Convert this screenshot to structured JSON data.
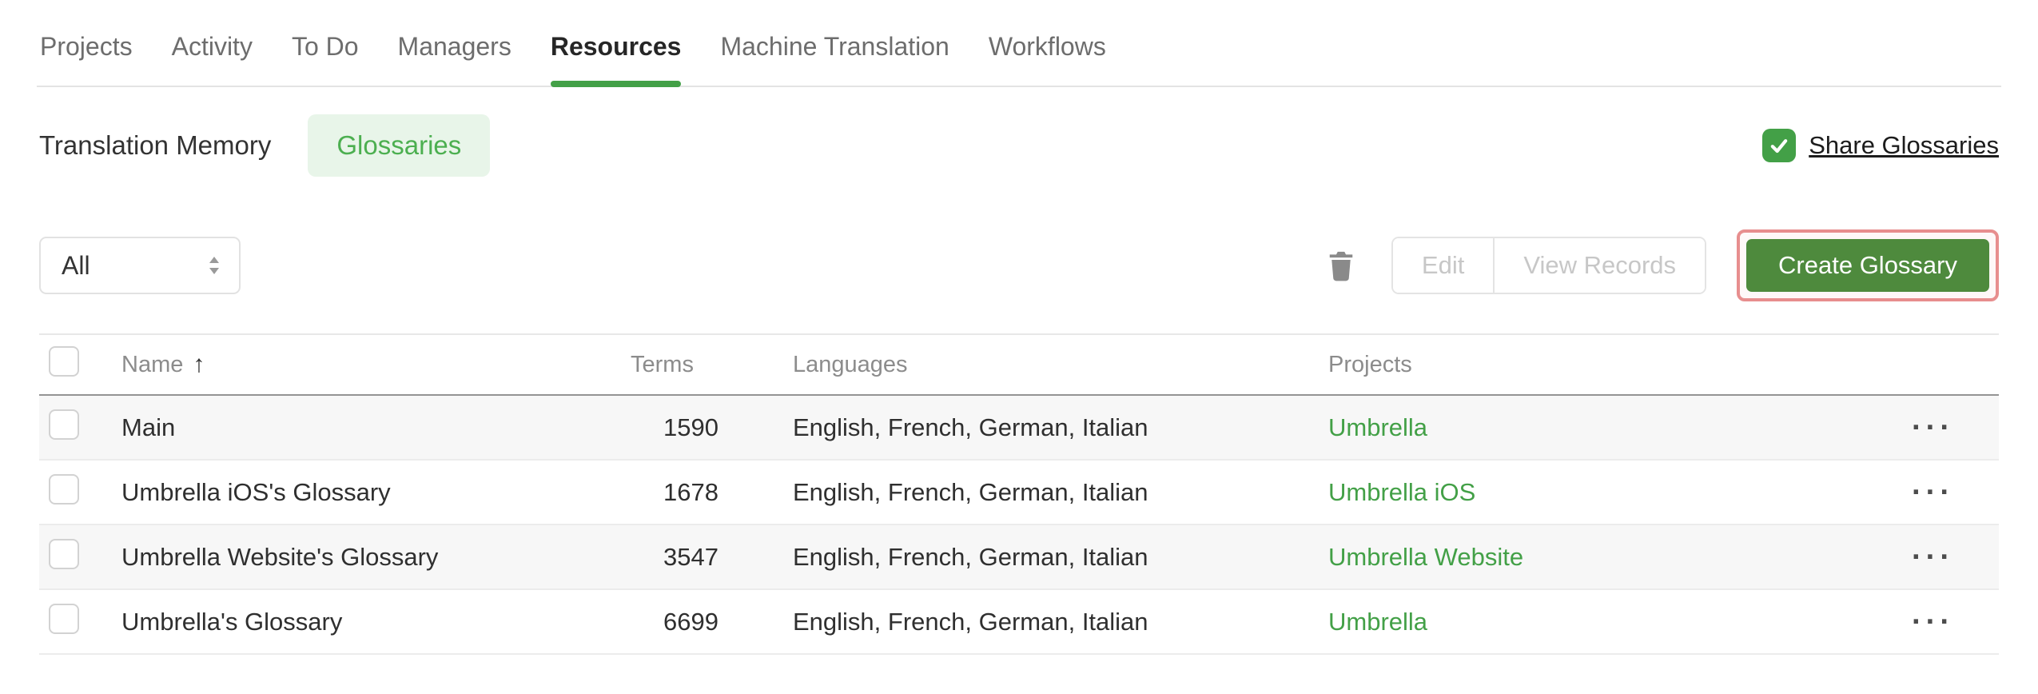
{
  "nav": {
    "tabs": [
      {
        "label": "Projects",
        "active": false
      },
      {
        "label": "Activity",
        "active": false
      },
      {
        "label": "To Do",
        "active": false
      },
      {
        "label": "Managers",
        "active": false
      },
      {
        "label": "Resources",
        "active": true
      },
      {
        "label": "Machine Translation",
        "active": false
      },
      {
        "label": "Workflows",
        "active": false
      }
    ]
  },
  "subnav": {
    "tabs": [
      {
        "label": "Translation Memory",
        "active": false
      },
      {
        "label": "Glossaries",
        "active": true
      }
    ],
    "share_glossaries_label": "Share Glossaries",
    "share_glossaries_checked": true
  },
  "toolbar": {
    "filter_value": "All",
    "edit_label": "Edit",
    "view_records_label": "View Records",
    "create_glossary_label": "Create Glossary"
  },
  "table": {
    "columns": [
      "Name",
      "Terms",
      "Languages",
      "Projects"
    ],
    "rows": [
      {
        "name": "Main",
        "terms": "1590",
        "languages": "English, French, German, Italian",
        "project": "Umbrella"
      },
      {
        "name": "Umbrella iOS's Glossary",
        "terms": "1678",
        "languages": "English, French, German, Italian",
        "project": "Umbrella iOS"
      },
      {
        "name": "Umbrella Website's Glossary",
        "terms": "3547",
        "languages": "English, French, German, Italian",
        "project": "Umbrella Website"
      },
      {
        "name": "Umbrella's Glossary",
        "terms": "6699",
        "languages": "English, French, German, Italian",
        "project": "Umbrella"
      }
    ]
  },
  "icons": {
    "sort_asc": "↑",
    "row_menu": "···"
  },
  "colors": {
    "accent_green": "#43a047",
    "pill_green_bg": "#e8f5e9",
    "button_green": "#4e8a3d",
    "highlight_red": "#e78e8e",
    "disabled_text": "#c7c7c7"
  }
}
